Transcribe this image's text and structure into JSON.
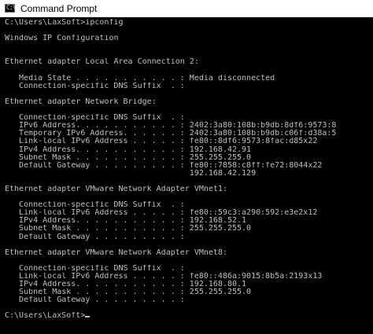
{
  "window": {
    "title": "Command Prompt",
    "icon": "cmd-icon",
    "icon_glyph": "C:\\"
  },
  "console": {
    "lines": [
      "C:\\Users\\LaxSoft>ipconfig",
      "",
      "Windows IP Configuration",
      "",
      "",
      "Ethernet adapter Local Area Connection 2:",
      "",
      "   Media State . . . . . . . . . . . : Media disconnected",
      "   Connection-specific DNS Suffix  . :",
      "",
      "Ethernet adapter Network Bridge:",
      "",
      "   Connection-specific DNS Suffix  . :",
      "   IPv6 Address. . . . . . . . . . . : 2402:3a80:108b:b9db:8df6:9573:8",
      "   Temporary IPv6 Address. . . . . . : 2402:3a80:108b:b9db:c06f:d38a:5",
      "   Link-local IPv6 Address . . . . . : fe80::8df6:9573:8fac:d85x22",
      "   IPv4 Address. . . . . . . . . . . : 192.168.42.91",
      "   Subnet Mask . . . . . . . . . . . : 255.255.255.0",
      "   Default Gateway . . . . . . . . . : fe80::7858:c8ff:fe72:8044x22",
      "                                       192.168.42.129",
      "",
      "Ethernet adapter VMware Network Adapter VMnet1:",
      "",
      "   Connection-specific DNS Suffix  . :",
      "   Link-local IPv6 Address . . . . . : fe80::59c3:a290:592:e3e2x12",
      "   IPv4 Address. . . . . . . . . . . : 192.168.52.1",
      "   Subnet Mask . . . . . . . . . . . : 255.255.255.0",
      "   Default Gateway . . . . . . . . . :",
      "",
      "Ethernet adapter VMware Network Adapter VMnet8:",
      "",
      "   Connection-specific DNS Suffix  . :",
      "   Link-local IPv6 Address . . . . . : fe80::486a:9015:8b5a:2193x13",
      "   IPv4 Address. . . . . . . . . . . : 192.168.80.1",
      "   Subnet Mask . . . . . . . . . . . : 255.255.255.0",
      "   Default Gateway . . . . . . . . . :",
      "",
      "C:\\Users\\LaxSoft>"
    ]
  },
  "colors": {
    "console_background": "#000000",
    "console_text": "#c0c0c0",
    "titlebar_background": "#ffffff",
    "title_text": "#000000"
  }
}
